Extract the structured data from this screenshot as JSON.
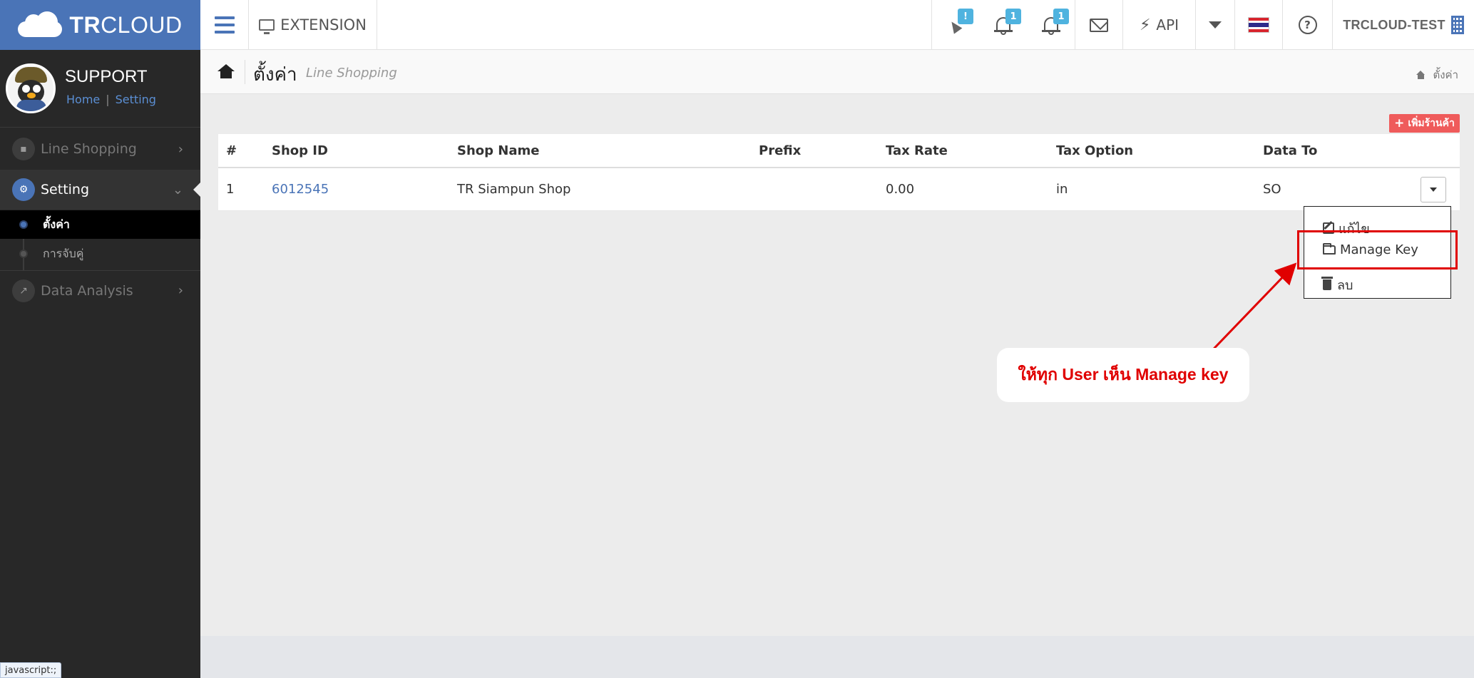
{
  "header": {
    "logo_bold": "TR",
    "logo_thin": "CLOUD",
    "extension_label": "EXTENSION",
    "party_badge": "!",
    "bell1_badge": "1",
    "bell2_badge": "1",
    "api_label": "API",
    "user_label": "TRCLOUD-TEST",
    "help_symbol": "?",
    "flag_colors": [
      "#d8252e",
      "#ffffff",
      "#2d2a8a",
      "#ffffff",
      "#d8252e"
    ]
  },
  "profile": {
    "name": "SUPPORT",
    "link_home": "Home",
    "link_separator": "|",
    "link_setting": "Setting"
  },
  "sidebar": {
    "line_shopping": "Line Shopping",
    "setting": "Setting",
    "sub_settings": "ตั้งค่า",
    "sub_matching": "การจับคู่",
    "data_analysis": "Data Analysis"
  },
  "breadcrumb": {
    "title": "ตั้งค่า",
    "subtitle": "Line Shopping",
    "right_label": "ตั้งค่า"
  },
  "actions": {
    "add_shop_plus": "+",
    "add_shop": "เพิ่มร้านค้า"
  },
  "table": {
    "headers": [
      "#",
      "Shop ID",
      "Shop Name",
      "Prefix",
      "Tax Rate",
      "Tax Option",
      "Data To"
    ],
    "rows": [
      {
        "num": "1",
        "shop_id": "6012545",
        "shop_name": "TR Siampun Shop",
        "prefix": "",
        "tax_rate": "0.00",
        "tax_option": "in",
        "data_to": "SO"
      }
    ]
  },
  "dropdown": {
    "edit": "แก้ไข",
    "manage_key": "Manage Key",
    "delete": "ลบ"
  },
  "annotation": {
    "callout": "ให้ทุก User เห็น Manage key",
    "color": "#e00000"
  },
  "status_tip": "javascript:;"
}
